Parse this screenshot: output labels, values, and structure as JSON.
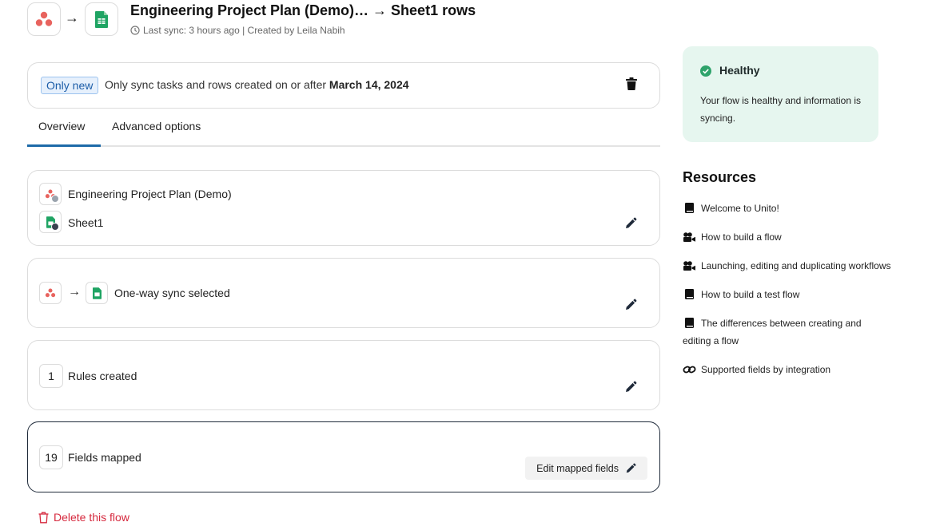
{
  "header": {
    "title": "Engineering Project Plan (Demo)… → Sheet1 rows",
    "arrow": "→",
    "last_sync": "Last sync: 3 hours ago | Created by Leila Nabih"
  },
  "notice": {
    "badge": "Only new",
    "text": "Only sync tasks and rows created on or after",
    "date": "March 14, 2024"
  },
  "tabs": [
    {
      "label": "Overview",
      "active": true
    },
    {
      "label": "Advanced options",
      "active": false
    }
  ],
  "connections": {
    "source_name": "Engineering Project Plan (Demo)",
    "target_name": "Sheet1"
  },
  "sync_direction": {
    "arrow": "→",
    "label": "One-way sync selected"
  },
  "rules": {
    "count": "1",
    "label": "Rules created"
  },
  "fields": {
    "count": "19",
    "label": "Fields mapped",
    "edit_button": "Edit mapped fields"
  },
  "delete": {
    "label": "Delete this flow"
  },
  "health": {
    "status": "Healthy",
    "message": "Your flow is healthy and information is syncing."
  },
  "resources": {
    "title": "Resources",
    "items": [
      {
        "label": "Welcome to Unito!",
        "icon": "book-icon"
      },
      {
        "label": "How to build a flow",
        "icon": "video-icon"
      },
      {
        "label": "Launching, editing and duplicating workflows",
        "icon": "video-icon"
      },
      {
        "label": "How to build a test flow",
        "icon": "book-icon"
      },
      {
        "label": "The differences between creating and editing a flow",
        "icon": "book-icon"
      },
      {
        "label": "Supported fields by integration",
        "icon": "link-icon"
      }
    ]
  },
  "colors": {
    "asana": "#e8635e",
    "sheets": "#1fa463",
    "accent": "#1d6aa8",
    "danger": "#d6293e",
    "healthy_bg": "#e6f6ef",
    "healthy_check": "#2ea36b"
  }
}
